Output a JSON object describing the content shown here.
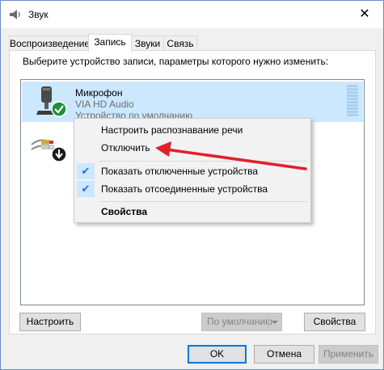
{
  "window": {
    "title": "Звук",
    "close_glyph": "✕"
  },
  "tabs": [
    {
      "label": "Воспроизведение",
      "active": false
    },
    {
      "label": "Запись",
      "active": true
    },
    {
      "label": "Звуки",
      "active": false
    },
    {
      "label": "Связь",
      "active": false
    }
  ],
  "panel": {
    "instruction": "Выберите устройство записи, параметры которого нужно изменить:"
  },
  "devices": [
    {
      "name": "Микрофон",
      "driver": "VIA HD Audio",
      "status": "Устройство по умолчанию",
      "selected": true,
      "icon": "microphone-icon",
      "badge": "default-check-icon"
    },
    {
      "name": "",
      "driver": "",
      "status": "",
      "selected": false,
      "icon": "line-in-icon",
      "badge": "down-arrow-icon"
    }
  ],
  "context_menu": {
    "items": [
      {
        "label": "Настроить распознавание речи",
        "checked": false,
        "bold": false
      },
      {
        "label": "Отключить",
        "checked": false,
        "bold": false
      },
      {
        "label": "Показать отключенные устройства",
        "checked": true,
        "bold": false
      },
      {
        "label": "Показать отсоединенные устройства",
        "checked": true,
        "bold": false
      },
      {
        "label": "Свойства",
        "checked": false,
        "bold": true
      }
    ],
    "check_glyph": "✔"
  },
  "panel_buttons": {
    "configure": "Настроить",
    "set_default": "По умолчанию",
    "properties": "Свойства"
  },
  "dialog_buttons": {
    "ok": "OK",
    "cancel": "Отмена",
    "apply": "Применить"
  },
  "colors": {
    "selection": "#cce8ff",
    "annotation_arrow": "#e0202b",
    "check_badge": "#1f8f3a"
  }
}
